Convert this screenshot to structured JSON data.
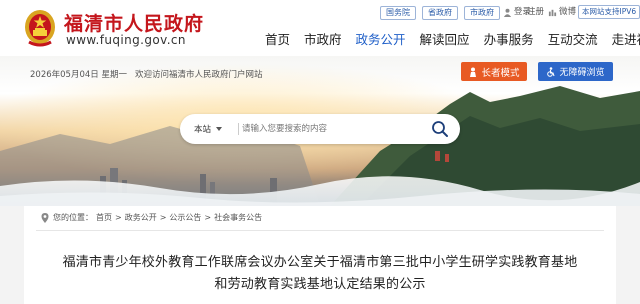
{
  "header": {
    "site_title": "福清市人民政府",
    "site_url": "www.fuqing.gov.cn",
    "top_links": [
      "国务院",
      "省政府",
      "市政府"
    ],
    "utilities": {
      "login": "登录",
      "register": "注册",
      "weibo": "微博"
    },
    "ipv6": "本网站支持IPV6"
  },
  "nav": {
    "items": [
      "首页",
      "市政府",
      "政务公开",
      "解读回应",
      "办事服务",
      "互动交流",
      "走进福清"
    ],
    "active": "政务公开"
  },
  "topbar": {
    "date": "2026年05月04日 星期一",
    "welcome": "欢迎访问福清市人民政府门户网站",
    "elder_mode_label": "长者模式",
    "accessible_label": "无障碍浏览"
  },
  "search": {
    "scope": "本站",
    "placeholder": "请输入您要搜索的内容"
  },
  "breadcrumb": {
    "prefix": "您的位置：",
    "items": [
      "首页",
      "政务公开",
      "公示公告",
      "社会事务公告"
    ],
    "separator": ">"
  },
  "article": {
    "title": "福清市青少年校外教育工作联席会议办公室关于福清市第三批中小学生研学实践教育基地和劳动教育实践基地认定结果的公示"
  },
  "colors": {
    "brand_red": "#c4161c",
    "nav_active": "#1f5fc8",
    "elder_button": "#e85a23",
    "access_button": "#2d67c9"
  },
  "icons": {
    "emblem": "national-emblem-icon",
    "search": "search-icon",
    "elder": "person-icon",
    "accessible": "wheelchair-icon"
  }
}
